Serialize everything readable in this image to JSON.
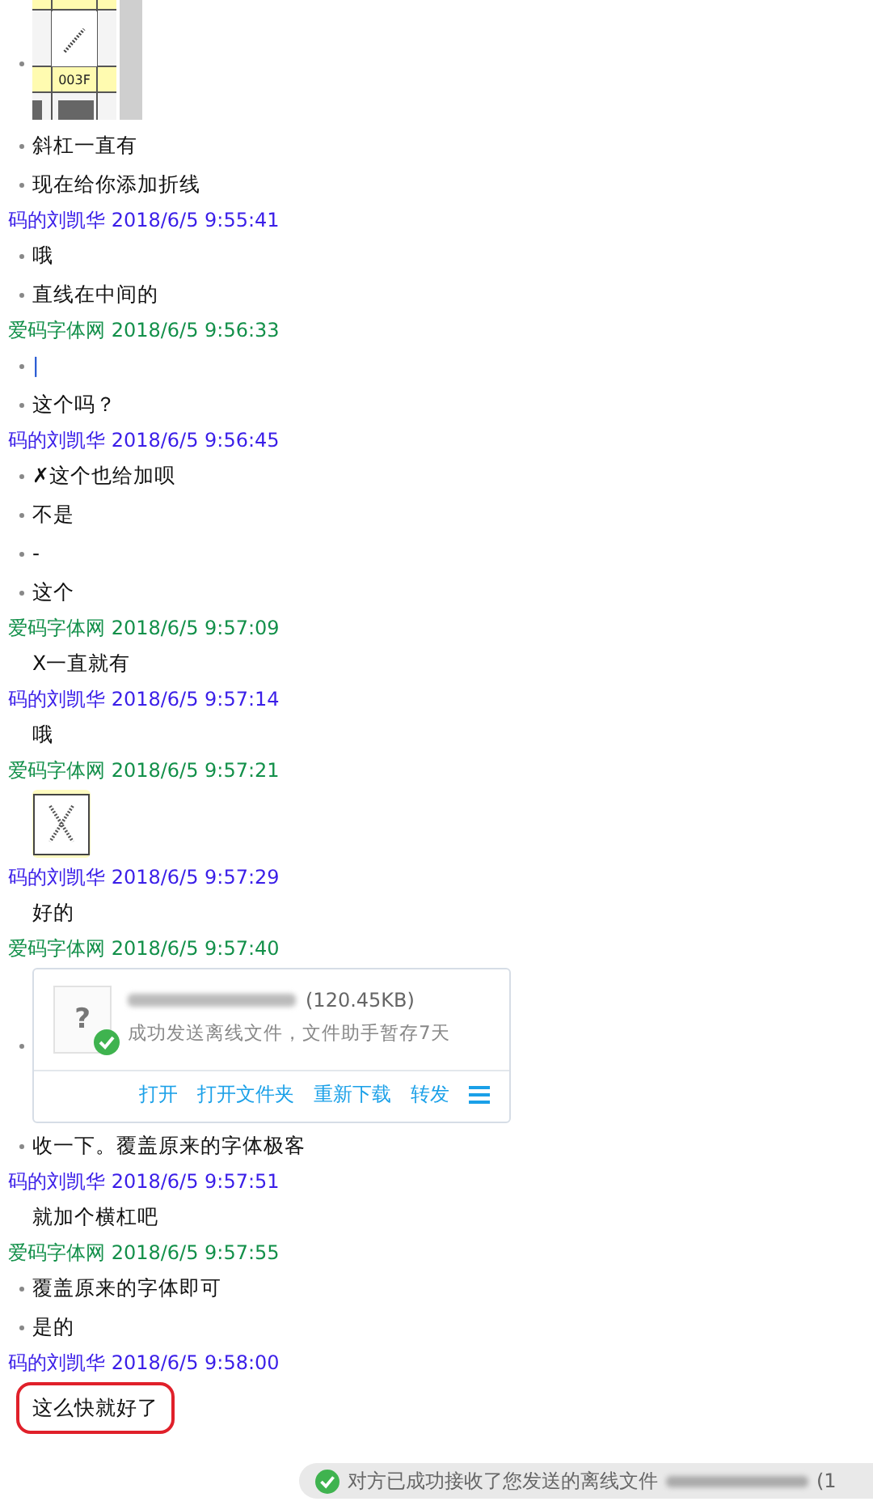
{
  "entries": [
    {
      "kind": "grid_image",
      "bullet": true,
      "label": "003F"
    },
    {
      "kind": "msg",
      "bullet": true,
      "text": "斜杠一直有"
    },
    {
      "kind": "msg",
      "bullet": true,
      "text": "现在给你添加折线"
    },
    {
      "kind": "header",
      "sender": "码的刘凯华",
      "time": "2018/6/5 9:55:41",
      "color": "#3a1ee8"
    },
    {
      "kind": "msg",
      "bullet": true,
      "text": "哦"
    },
    {
      "kind": "msg",
      "bullet": true,
      "text": "直线在中间的"
    },
    {
      "kind": "header",
      "sender": "爱码字体网",
      "time": "2018/6/5 9:56:33",
      "color": "#13904a"
    },
    {
      "kind": "bar",
      "bullet": true,
      "text": "|"
    },
    {
      "kind": "msg",
      "bullet": true,
      "text": "这个吗？"
    },
    {
      "kind": "header",
      "sender": "码的刘凯华",
      "time": "2018/6/5 9:56:45",
      "color": "#3a1ee8"
    },
    {
      "kind": "msg",
      "bullet": true,
      "text": "✗这个也给加呗"
    },
    {
      "kind": "msg",
      "bullet": true,
      "text": "不是"
    },
    {
      "kind": "msg",
      "bullet": true,
      "text": "-"
    },
    {
      "kind": "msg",
      "bullet": true,
      "text": "这个"
    },
    {
      "kind": "header",
      "sender": "爱码字体网",
      "time": "2018/6/5 9:57:09",
      "color": "#13904a"
    },
    {
      "kind": "msg",
      "bullet": false,
      "text": "X一直就有"
    },
    {
      "kind": "header",
      "sender": "码的刘凯华",
      "time": "2018/6/5 9:57:14",
      "color": "#3a1ee8"
    },
    {
      "kind": "msg",
      "bullet": false,
      "text": "哦"
    },
    {
      "kind": "header",
      "sender": "爱码字体网",
      "time": "2018/6/5 9:57:21",
      "color": "#13904a"
    },
    {
      "kind": "glyph_image",
      "bullet": false
    },
    {
      "kind": "header",
      "sender": "码的刘凯华",
      "time": "2018/6/5 9:57:29",
      "color": "#3a1ee8"
    },
    {
      "kind": "msg",
      "bullet": false,
      "text": "好的"
    },
    {
      "kind": "header",
      "sender": "爱码字体网",
      "time": "2018/6/5 9:57:40",
      "color": "#13904a"
    },
    {
      "kind": "file",
      "bullet": true,
      "icon": "?",
      "size": "(120.45KB)",
      "status": "成功发送离线文件，文件助手暂存7天",
      "actions": [
        "打开",
        "打开文件夹",
        "重新下载",
        "转发"
      ]
    },
    {
      "kind": "msg",
      "bullet": true,
      "text": "收一下。覆盖原来的字体极客"
    },
    {
      "kind": "header",
      "sender": "码的刘凯华",
      "time": "2018/6/5 9:57:51",
      "color": "#3a1ee8"
    },
    {
      "kind": "msg",
      "bullet": false,
      "text": "就加个横杠吧"
    },
    {
      "kind": "header",
      "sender": "爱码字体网",
      "time": "2018/6/5 9:57:55",
      "color": "#13904a"
    },
    {
      "kind": "msg",
      "bullet": true,
      "text": "覆盖原来的字体即可"
    },
    {
      "kind": "msg",
      "bullet": true,
      "text": "是的"
    },
    {
      "kind": "header",
      "sender": "码的刘凯华",
      "time": "2018/6/5 9:58:00",
      "color": "#3a1ee8"
    },
    {
      "kind": "msg",
      "bullet": false,
      "highlighted": true,
      "text": "这么快就好了"
    }
  ],
  "notice": {
    "text": "对方已成功接收了您发送的离线文件",
    "tail": "(1"
  }
}
